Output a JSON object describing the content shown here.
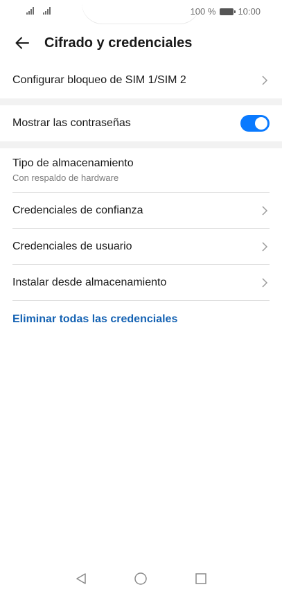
{
  "status": {
    "battery_text": "100 %",
    "time": "10:00"
  },
  "header": {
    "title": "Cifrado y credenciales"
  },
  "sim_section": {
    "label": "Configurar bloqueo de SIM 1/SIM 2"
  },
  "password_section": {
    "label": "Mostrar las contraseñas",
    "toggle_on": true
  },
  "storage_section": {
    "items": [
      {
        "label": "Tipo de almacenamiento",
        "sub": "Con respaldo de hardware"
      },
      {
        "label": "Credenciales de confianza"
      },
      {
        "label": "Credenciales de usuario"
      },
      {
        "label": "Instalar desde almacenamiento"
      }
    ]
  },
  "actions": {
    "clear_all": "Eliminar todas las credenciales"
  },
  "colors": {
    "accent": "#0a7aff",
    "link": "#1462b3",
    "section_gap": "#f2f2f2"
  },
  "icons": [
    "back-arrow-icon",
    "chevron-right-icon",
    "signal-icon",
    "battery-icon",
    "nav-back-icon",
    "nav-home-icon",
    "nav-recents-icon"
  ]
}
